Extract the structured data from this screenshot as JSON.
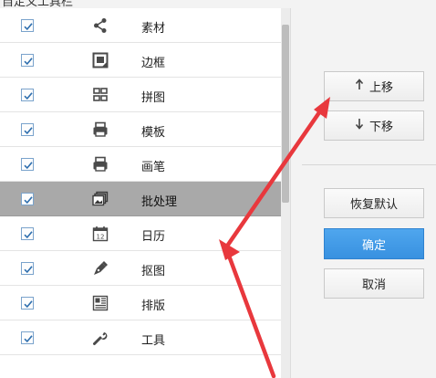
{
  "window": {
    "title": "自定义工具栏"
  },
  "items": [
    {
      "label": "素材",
      "checked": true,
      "icon": "share-icon",
      "selected": false
    },
    {
      "label": "边框",
      "checked": true,
      "icon": "frame-icon",
      "selected": false
    },
    {
      "label": "拼图",
      "checked": true,
      "icon": "grid-icon",
      "selected": false
    },
    {
      "label": "模板",
      "checked": true,
      "icon": "template-icon",
      "selected": false
    },
    {
      "label": "画笔",
      "checked": true,
      "icon": "brush-icon",
      "selected": false
    },
    {
      "label": "批处理",
      "checked": true,
      "icon": "batch-icon",
      "selected": true
    },
    {
      "label": "日历",
      "checked": true,
      "icon": "calendar-icon",
      "selected": false
    },
    {
      "label": "抠图",
      "checked": true,
      "icon": "pen-tool-icon",
      "selected": false
    },
    {
      "label": "排版",
      "checked": true,
      "icon": "layout-icon",
      "selected": false
    },
    {
      "label": "工具",
      "checked": true,
      "icon": "wrench-icon",
      "selected": false
    }
  ],
  "buttons": {
    "move_up": "上移",
    "move_down": "下移",
    "restore_default": "恢复默认",
    "ok": "确定",
    "cancel": "取消"
  },
  "colors": {
    "primary": "#3f9be6",
    "selected_row": "#a9a9a9",
    "annotation_arrow": "#e8383d",
    "checkbox_border": "#7aa3cc"
  }
}
